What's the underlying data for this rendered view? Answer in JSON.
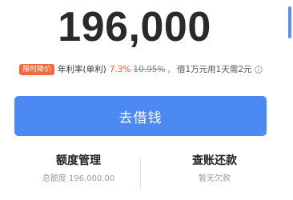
{
  "loan": {
    "amount": "196,000",
    "badge": "限时降价",
    "rate_label": "年利率(单利)",
    "rate_new": "7.3%",
    "rate_old": "10.95%",
    "rate_separator": "，",
    "rate_desc": "借1万元用1天需2元"
  },
  "actions": {
    "borrow_label": "去借钱"
  },
  "quota": {
    "title": "额度管理",
    "subtitle": "总额度 196,000.00"
  },
  "bills": {
    "title": "查账还款",
    "subtitle": "暂无欠款"
  },
  "colors": {
    "primary": "#4d89f2",
    "badge": "#f06a3c",
    "rate_highlight": "#f05a2a"
  }
}
